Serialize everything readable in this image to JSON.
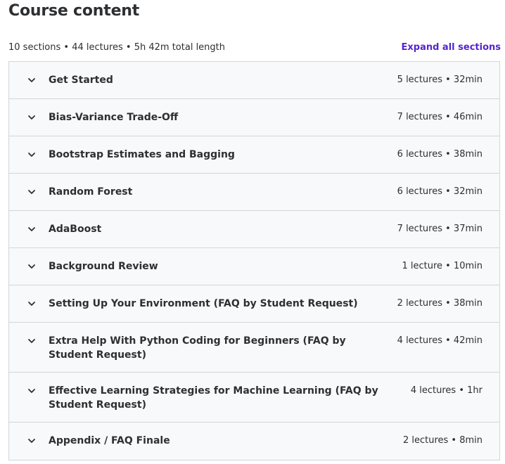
{
  "header": {
    "title": "Course content",
    "summary": "10 sections • 44 lectures • 5h 42m total length",
    "expand_label": "Expand all sections"
  },
  "sections": [
    {
      "title": "Get Started",
      "meta": "5 lectures • 32min"
    },
    {
      "title": "Bias-Variance Trade-Off",
      "meta": "7 lectures • 46min"
    },
    {
      "title": "Bootstrap Estimates and Bagging",
      "meta": "6 lectures • 38min"
    },
    {
      "title": "Random Forest",
      "meta": "6 lectures • 32min"
    },
    {
      "title": "AdaBoost",
      "meta": "7 lectures • 37min"
    },
    {
      "title": "Background Review",
      "meta": "1 lecture • 10min"
    },
    {
      "title": "Setting Up Your Environment (FAQ by Student Request)",
      "meta": "2 lectures • 38min"
    },
    {
      "title": "Extra Help With Python Coding for Beginners (FAQ by Student Request)",
      "meta": "4 lectures • 42min"
    },
    {
      "title": "Effective Learning Strategies for Machine Learning (FAQ by Student Request)",
      "meta": "4 lectures • 1hr"
    },
    {
      "title": "Appendix / FAQ Finale",
      "meta": "2 lectures • 8min"
    }
  ],
  "icons": {
    "section_toggle": "chevron-down-icon"
  },
  "colors": {
    "text": "#2d2f31",
    "link": "#5624d0",
    "row_bg": "#f7f9fa",
    "border": "#d1d7dc"
  }
}
